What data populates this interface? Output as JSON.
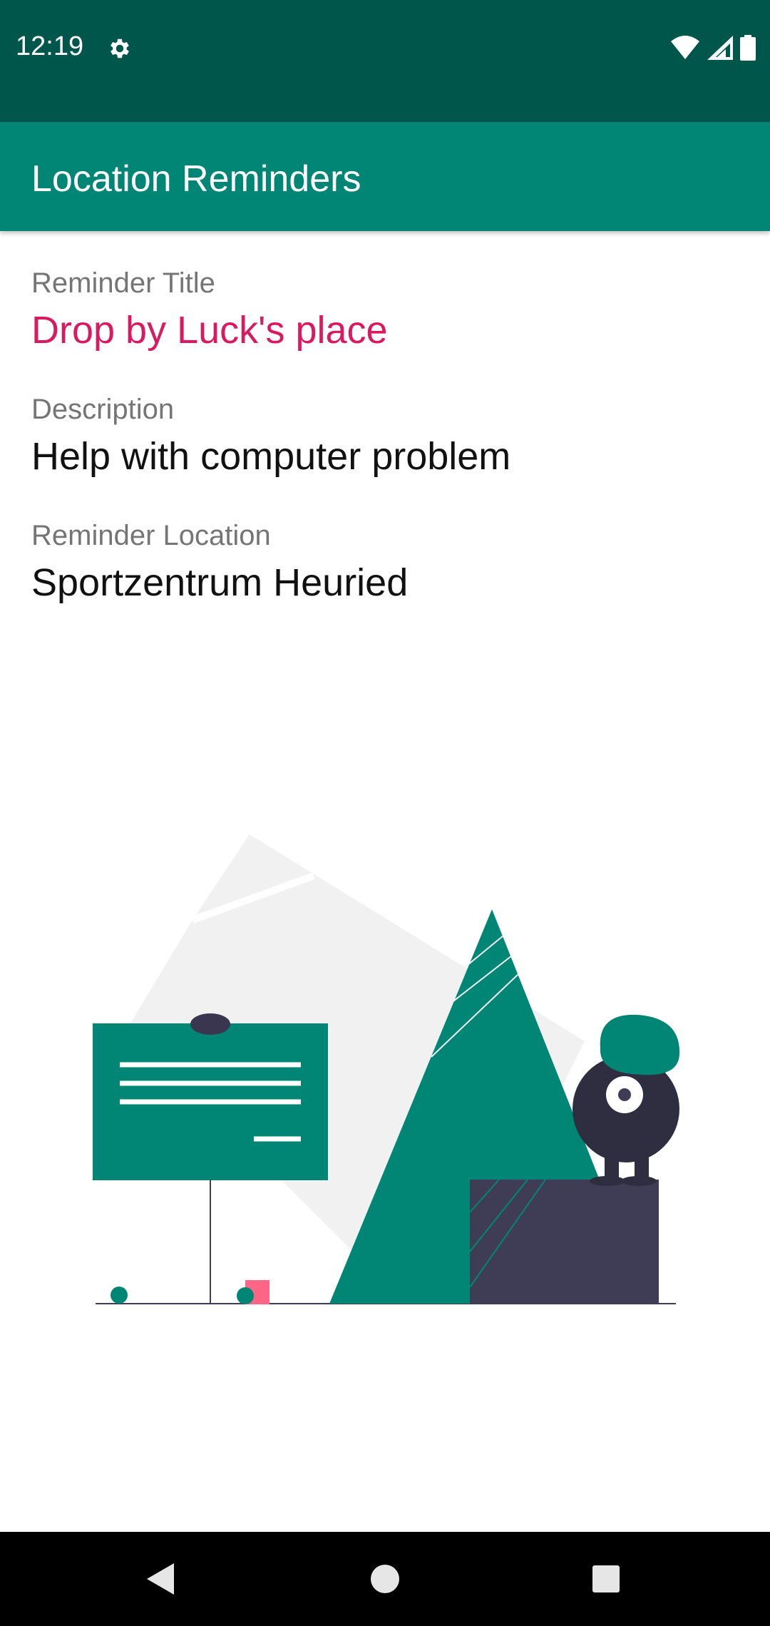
{
  "status_bar": {
    "time": "12:19",
    "icons": [
      "gear-icon",
      "wifi-icon",
      "signal-icon",
      "battery-icon"
    ]
  },
  "app_bar": {
    "title": "Location Reminders",
    "color": "#018574"
  },
  "reminder": {
    "title_label": "Reminder Title",
    "title_value": "Drop by Luck's place",
    "description_label": "Description",
    "description_value": "Help with computer problem",
    "location_label": "Reminder Location",
    "location_value": "Sportzentrum Heuried"
  },
  "colors": {
    "status_bar": "#00564b",
    "accent": "#d81b60",
    "primary": "#018574"
  },
  "navigation_bar": {
    "buttons": [
      "back-icon",
      "home-icon",
      "recents-icon"
    ]
  }
}
